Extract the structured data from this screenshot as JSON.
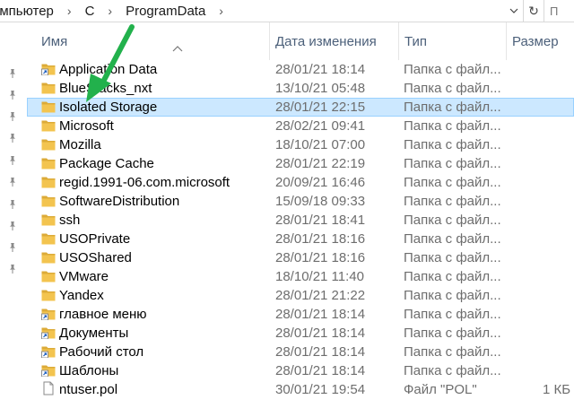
{
  "address": {
    "crumbs": [
      "омпьютер",
      "C",
      "ProgramData"
    ],
    "separator": "›",
    "refresh_glyph": "↻",
    "search_glyph": "П"
  },
  "columns": {
    "name": "Имя",
    "date": "Дата изменения",
    "type": "Тип",
    "size": "Размер"
  },
  "files": [
    {
      "name": "Application Data",
      "date": "28/01/21 18:14",
      "type": "Папка с файл...",
      "size": "",
      "icon": "folder-shortcut-icon"
    },
    {
      "name": "BlueStacks_nxt",
      "date": "13/10/21 05:48",
      "type": "Папка с файл...",
      "size": "",
      "icon": "folder-icon"
    },
    {
      "name": "Isolated Storage",
      "date": "28/01/21 22:15",
      "type": "Папка с файл...",
      "size": "",
      "icon": "folder-icon",
      "selected": true
    },
    {
      "name": "Microsoft",
      "date": "28/02/21 09:41",
      "type": "Папка с файл...",
      "size": "",
      "icon": "folder-icon"
    },
    {
      "name": "Mozilla",
      "date": "18/10/21 07:00",
      "type": "Папка с файл...",
      "size": "",
      "icon": "folder-icon"
    },
    {
      "name": "Package Cache",
      "date": "28/01/21 22:19",
      "type": "Папка с файл...",
      "size": "",
      "icon": "folder-icon"
    },
    {
      "name": "regid.1991-06.com.microsoft",
      "date": "20/09/21 16:46",
      "type": "Папка с файл...",
      "size": "",
      "icon": "folder-icon"
    },
    {
      "name": "SoftwareDistribution",
      "date": "15/09/18 09:33",
      "type": "Папка с файл...",
      "size": "",
      "icon": "folder-icon"
    },
    {
      "name": "ssh",
      "date": "28/01/21 18:41",
      "type": "Папка с файл...",
      "size": "",
      "icon": "folder-icon"
    },
    {
      "name": "USOPrivate",
      "date": "28/01/21 18:16",
      "type": "Папка с файл...",
      "size": "",
      "icon": "folder-icon"
    },
    {
      "name": "USOShared",
      "date": "28/01/21 18:16",
      "type": "Папка с файл...",
      "size": "",
      "icon": "folder-icon"
    },
    {
      "name": "VMware",
      "date": "18/10/21 11:40",
      "type": "Папка с файл...",
      "size": "",
      "icon": "folder-icon"
    },
    {
      "name": "Yandex",
      "date": "28/01/21 21:22",
      "type": "Папка с файл...",
      "size": "",
      "icon": "folder-icon"
    },
    {
      "name": "главное меню",
      "date": "28/01/21 18:14",
      "type": "Папка с файл...",
      "size": "",
      "icon": "folder-shortcut-icon"
    },
    {
      "name": "Документы",
      "date": "28/01/21 18:14",
      "type": "Папка с файл...",
      "size": "",
      "icon": "folder-shortcut-icon"
    },
    {
      "name": "Рабочий стол",
      "date": "28/01/21 18:14",
      "type": "Папка с файл...",
      "size": "",
      "icon": "folder-shortcut-icon"
    },
    {
      "name": "Шаблоны",
      "date": "28/01/21 18:14",
      "type": "Папка с файл...",
      "size": "",
      "icon": "folder-shortcut-icon"
    },
    {
      "name": "ntuser.pol",
      "date": "30/01/21 19:54",
      "type": "Файл \"POL\"",
      "size": "1 КБ",
      "icon": "file-icon"
    }
  ],
  "pinned_count": 10,
  "colors": {
    "folder": "#f3c44f",
    "folder_dark": "#dcab38",
    "selection": "#cce8ff",
    "selection_border": "#99d1ff",
    "header_text": "#4c607a",
    "annotation_arrow": "#22b14c",
    "shortcut_arrow": "#1f5fbf"
  },
  "annotation": {
    "icon": "green-arrow-icon"
  }
}
